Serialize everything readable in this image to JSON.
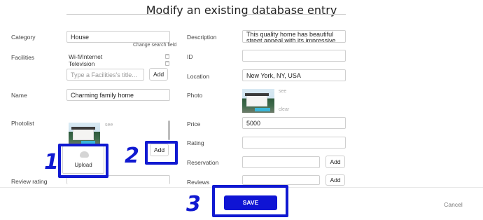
{
  "title": "Modify an existing database entry",
  "left": {
    "category": {
      "label": "Category",
      "value": "House",
      "hint": "Change search field"
    },
    "facilities": {
      "label": "Facilities",
      "items": [
        "Wi-fi/Internet",
        "Television"
      ],
      "input_placeholder": "Type a Facilities's title...",
      "add_label": "Add"
    },
    "name": {
      "label": "Name",
      "value": "Charming family home"
    },
    "photolist": {
      "label": "Photolist",
      "see_label": "see",
      "upload_label": "Upload",
      "add_label": "Add"
    },
    "review_rating": {
      "label": "Review rating",
      "value": ""
    }
  },
  "right": {
    "description": {
      "label": "Description",
      "value": "This quality home has beautiful street appeal with its impressive"
    },
    "id": {
      "label": "ID",
      "value": ""
    },
    "location": {
      "label": "Location",
      "value": "New York, NY, USA"
    },
    "photo": {
      "label": "Photo",
      "see_label": "see",
      "clear_label": "clear"
    },
    "price": {
      "label": "Price",
      "value": "5000"
    },
    "rating": {
      "label": "Rating",
      "value": ""
    },
    "reservation": {
      "label": "Reservation",
      "value": "",
      "add_label": "Add"
    },
    "reviews": {
      "label": "Reviews",
      "value": "",
      "add_label": "Add"
    }
  },
  "footer": {
    "save_label": "SAVE",
    "cancel_label": "Cancel"
  },
  "annotations": {
    "n1": "1",
    "n2": "2",
    "n3": "3"
  },
  "colors": {
    "accent": "#0f14d4",
    "annotation": "#1019d1"
  },
  "icons": [
    "trash-icon",
    "cloud-upload-icon"
  ]
}
